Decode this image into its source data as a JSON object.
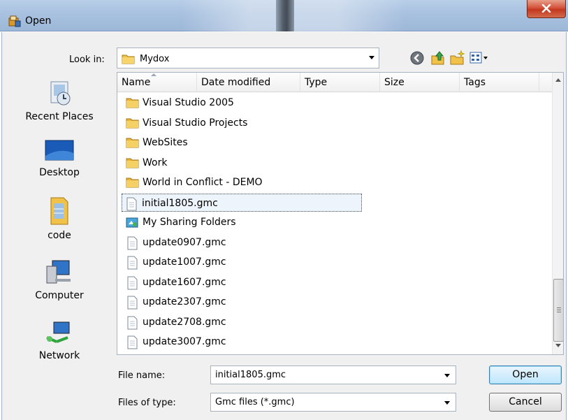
{
  "window": {
    "title": "Open",
    "close_label": "Close"
  },
  "lookin": {
    "label": "Look in:",
    "value": "Mydox"
  },
  "toolbar": {
    "icons": [
      "back-icon",
      "up-folder-icon",
      "new-folder-icon",
      "view-menu-icon"
    ]
  },
  "places": [
    {
      "label": "Recent Places",
      "icon": "recent-places-icon"
    },
    {
      "label": "Desktop",
      "icon": "desktop-icon"
    },
    {
      "label": "code",
      "icon": "code-folder-icon"
    },
    {
      "label": "Computer",
      "icon": "computer-icon"
    },
    {
      "label": "Network",
      "icon": "network-icon"
    }
  ],
  "columns": [
    "Name",
    "Date modified",
    "Type",
    "Size",
    "Tags"
  ],
  "files": [
    {
      "name": "Visual Studio 2005",
      "kind": "folder"
    },
    {
      "name": "Visual Studio Projects",
      "kind": "folder"
    },
    {
      "name": "WebSites",
      "kind": "folder"
    },
    {
      "name": "Work",
      "kind": "folder"
    },
    {
      "name": "World in Conflict - DEMO",
      "kind": "folder"
    },
    {
      "name": "initial1805.gmc",
      "kind": "file",
      "selected": true
    },
    {
      "name": "My Sharing Folders",
      "kind": "shared"
    },
    {
      "name": "update0907.gmc",
      "kind": "file"
    },
    {
      "name": "update1007.gmc",
      "kind": "file"
    },
    {
      "name": "update1607.gmc",
      "kind": "file"
    },
    {
      "name": "update2307.gmc",
      "kind": "file"
    },
    {
      "name": "update2708.gmc",
      "kind": "file"
    },
    {
      "name": "update3007.gmc",
      "kind": "file"
    }
  ],
  "filename": {
    "label": "File name:",
    "value": "initial1805.gmc"
  },
  "filetype": {
    "label": "Files of type:",
    "value": "Gmc files (*.gmc)"
  },
  "buttons": {
    "open": "Open",
    "cancel": "Cancel"
  }
}
